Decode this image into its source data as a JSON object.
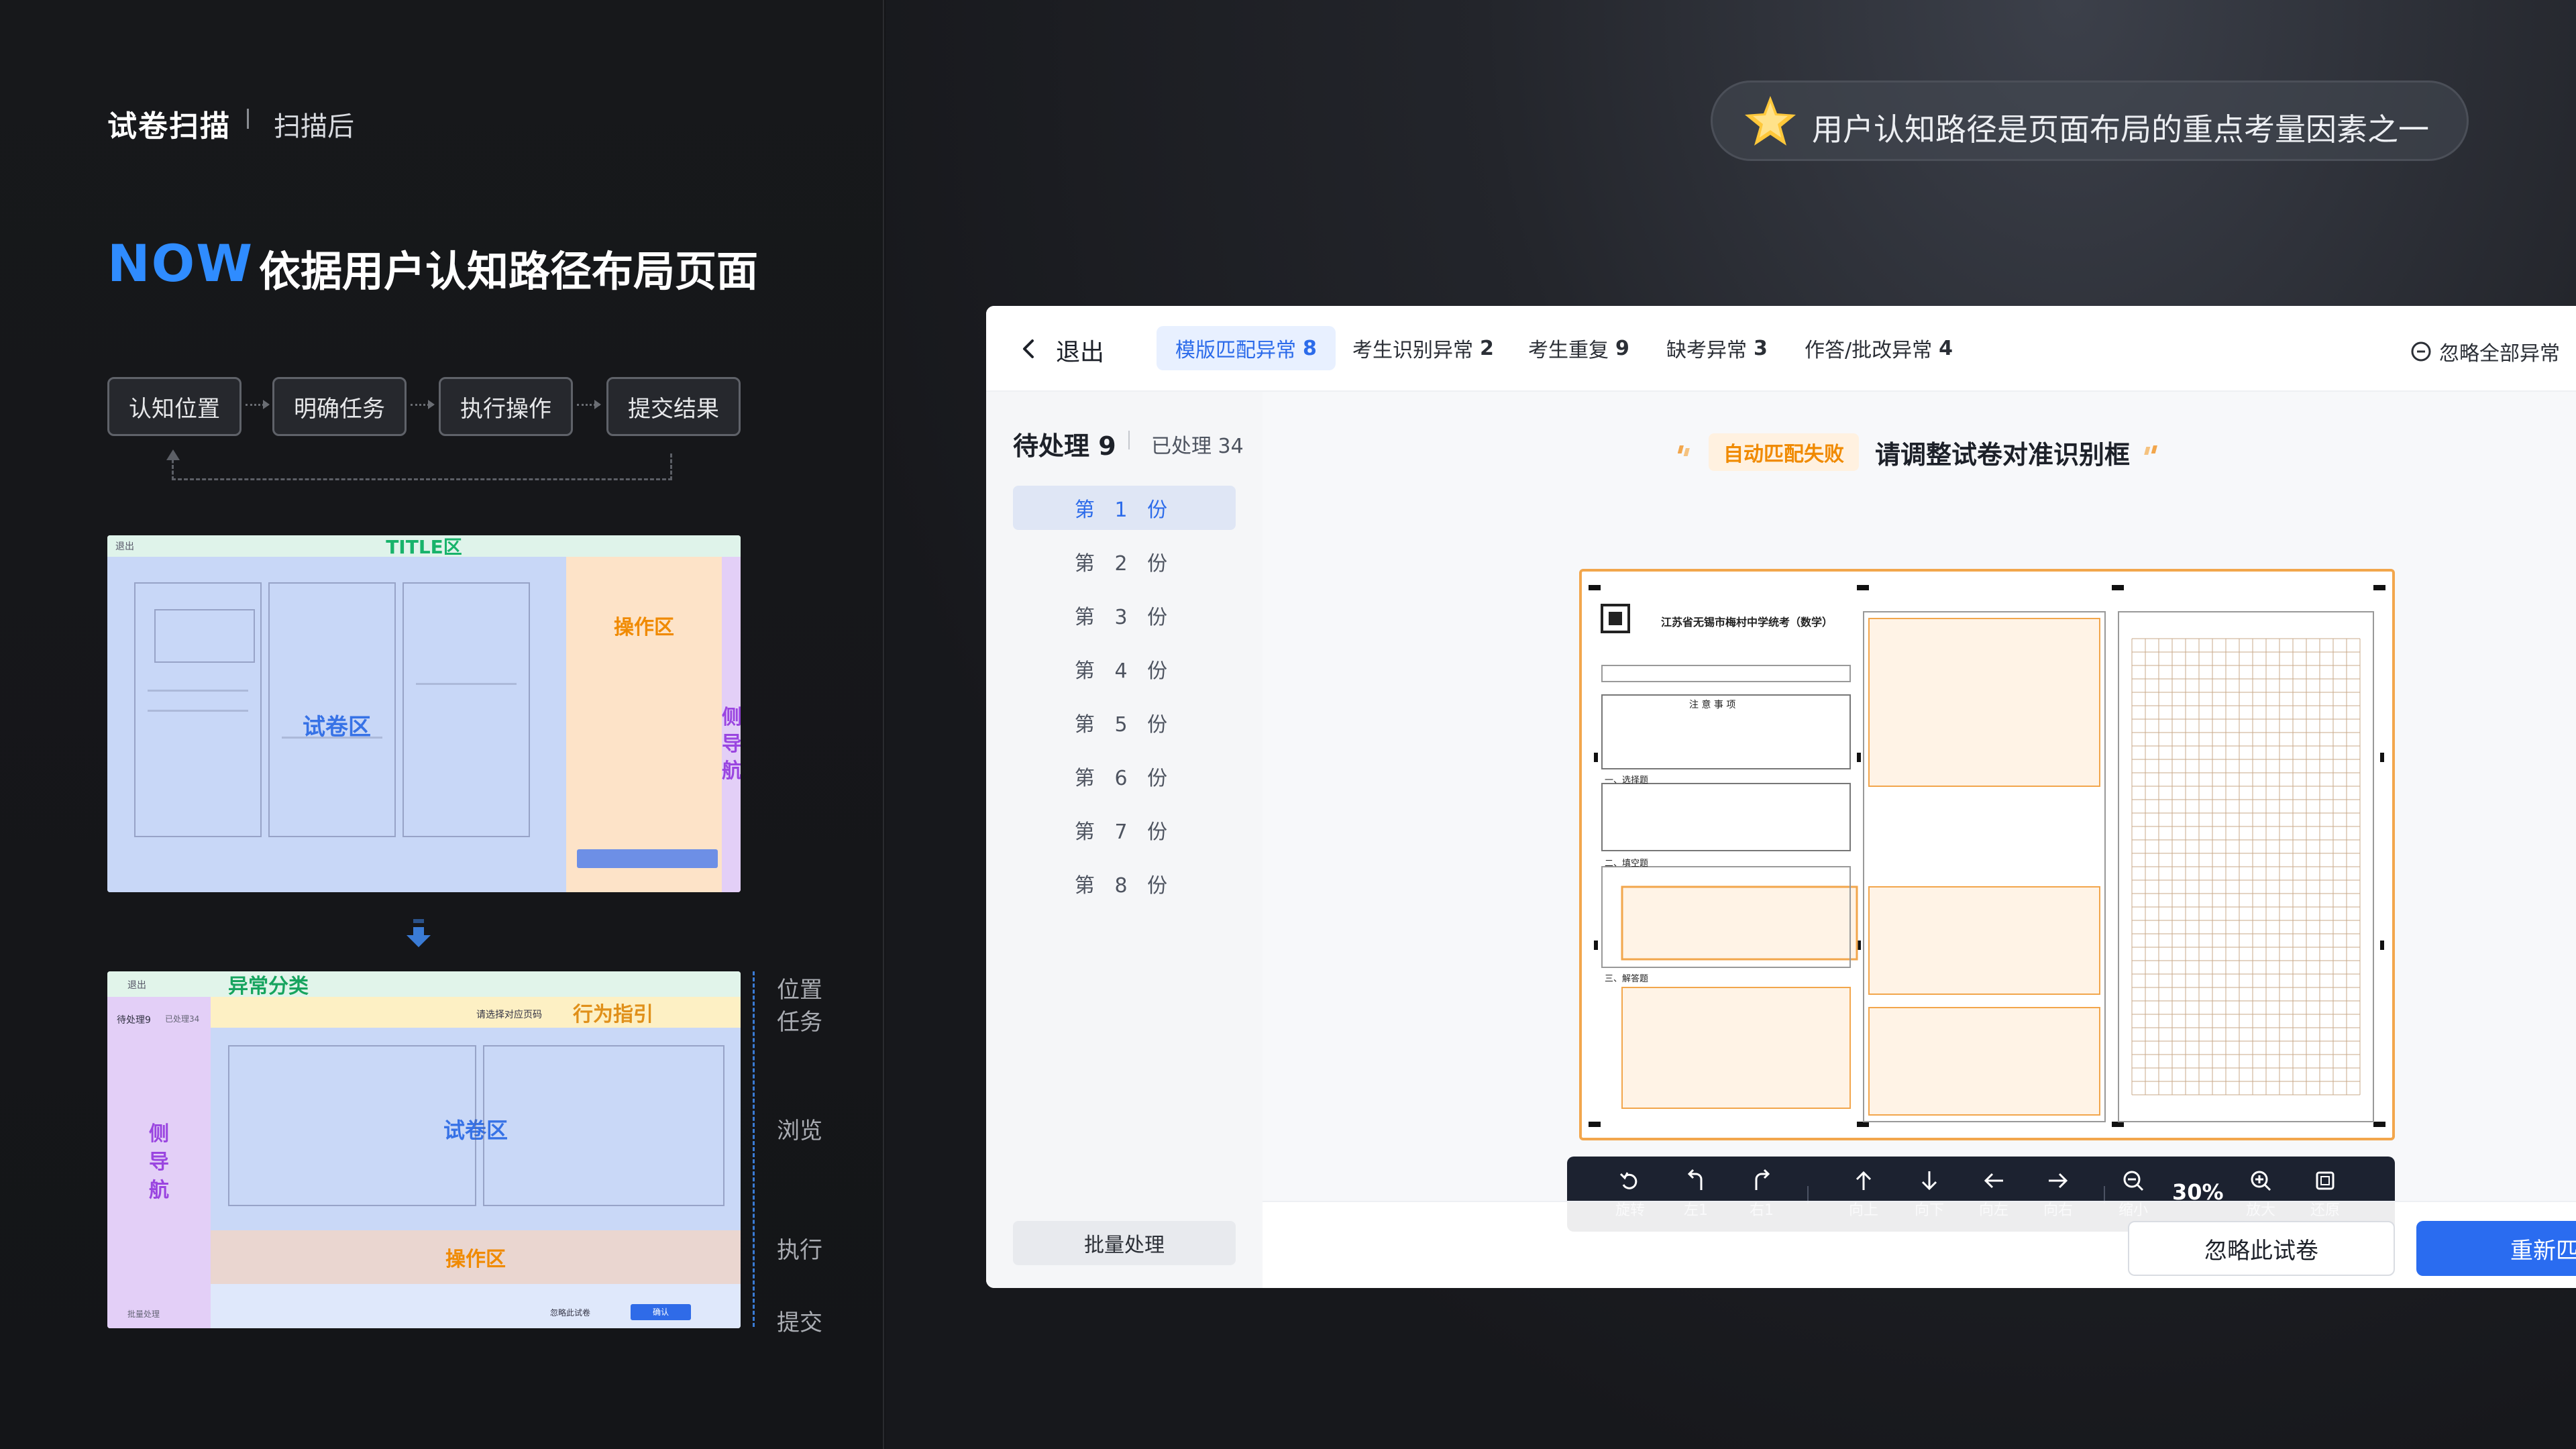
{
  "header": {
    "title": "试卷扫描",
    "subtitle": "扫描后"
  },
  "headline": {
    "now": "NOW",
    "text": "依据用户认知路径布局页面"
  },
  "steps": [
    "认知位置",
    "明确任务",
    "执行操作",
    "提交结果"
  ],
  "thumb1": {
    "title_zone": "TITLE区",
    "paper_zone": "试卷区",
    "op_zone": "操作区",
    "side_nav": "侧导航",
    "top_text": "退出"
  },
  "thumb2": {
    "category": "异常分类",
    "guide": "行为指引",
    "paper_zone": "试卷区",
    "op_zone": "操作区",
    "side_nav": "侧导航",
    "back": "退出",
    "guide_text": "请选择对应页码",
    "pending": "待处理9",
    "done": "已处理34",
    "batch": "批量处理",
    "ignore": "忽略此试卷",
    "confirm": "确认"
  },
  "side_labels": [
    "位置",
    "任务",
    "浏览",
    "执行",
    "提交"
  ],
  "tip": "用户认知路径是页面布局的重点考量因素之一",
  "window": {
    "back": "退出",
    "tabs": [
      {
        "label": "模版匹配异常",
        "count": "8"
      },
      {
        "label": "考生识别异常",
        "count": "2"
      },
      {
        "label": "考生重复",
        "count": "9"
      },
      {
        "label": "缺考异常",
        "count": "3"
      },
      {
        "label": "作答/批改异常",
        "count": "4"
      }
    ],
    "ignore_all": "忽略全部异常",
    "sidebar": {
      "pending": "待处理 9",
      "done": "已处理 34",
      "copies": [
        "第 1 份",
        "第 2 份",
        "第 3 份",
        "第 4 份",
        "第 5 份",
        "第 6 份",
        "第 7 份",
        "第 8 份"
      ],
      "batch": "批量处理"
    },
    "warning": {
      "tag": "自动匹配失败",
      "text": "请调整试卷对准识别框"
    },
    "sheet": {
      "title": "江苏省无锡市梅村中学统考（数学）",
      "notice": "注 意 事 项",
      "sec1": "一、选择题",
      "sec2": "二、填空题",
      "sec3": "三、解答题"
    },
    "toolbar": {
      "rotate": "旋转",
      "left1": "左1",
      "right1": "右1",
      "up": "向上",
      "down": "向下",
      "leftm": "向左",
      "rightm": "向右",
      "zoom_out": "缩小",
      "zoom": "30%",
      "zoom_in": "放大",
      "reset": "还原"
    },
    "ignore_btn": "忽略此试卷",
    "rematch_btn": "重新匹配"
  },
  "colors": {
    "accent": "#2c6bea",
    "warn": "#f08a00",
    "now": "#2f8cff"
  }
}
